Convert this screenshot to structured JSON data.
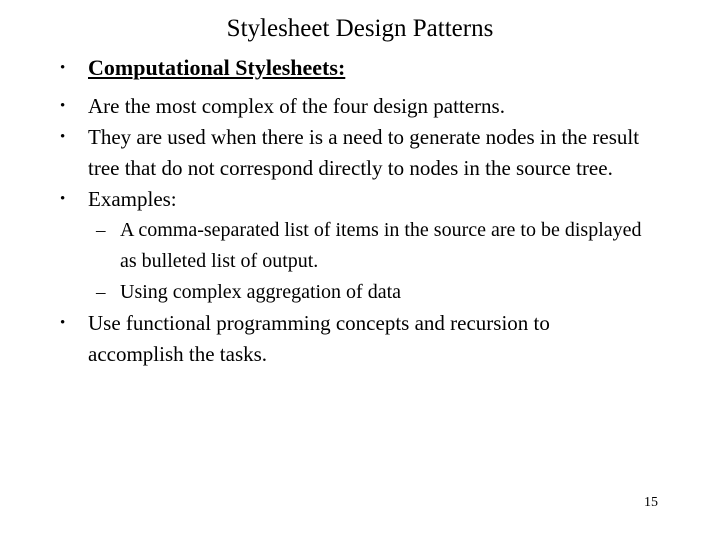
{
  "slide": {
    "title": "Stylesheet Design Patterns",
    "page_number": "15",
    "background_color": "#ffffff",
    "text_color": "#000000",
    "bullet_marker": "•",
    "dash_marker": "–",
    "bullets": [
      {
        "level": 1,
        "emphasis": true,
        "text": "Computational Stylesheets:"
      },
      {
        "level": 1,
        "emphasis": false,
        "text": "Are the most complex of the four design patterns."
      },
      {
        "level": 1,
        "emphasis": false,
        "text": "They are used when there is a need to generate nodes in the result tree that do not correspond directly to nodes in the source tree."
      },
      {
        "level": 1,
        "emphasis": false,
        "text": "Examples:"
      },
      {
        "level": 2,
        "emphasis": false,
        "text": "A comma-separated list of items in the source are to be displayed as bulleted list of output."
      },
      {
        "level": 2,
        "emphasis": false,
        "text": "Using complex aggregation of data"
      },
      {
        "level": 1,
        "emphasis": false,
        "text": "Use functional programming concepts and recursion to accomplish the tasks."
      }
    ]
  }
}
